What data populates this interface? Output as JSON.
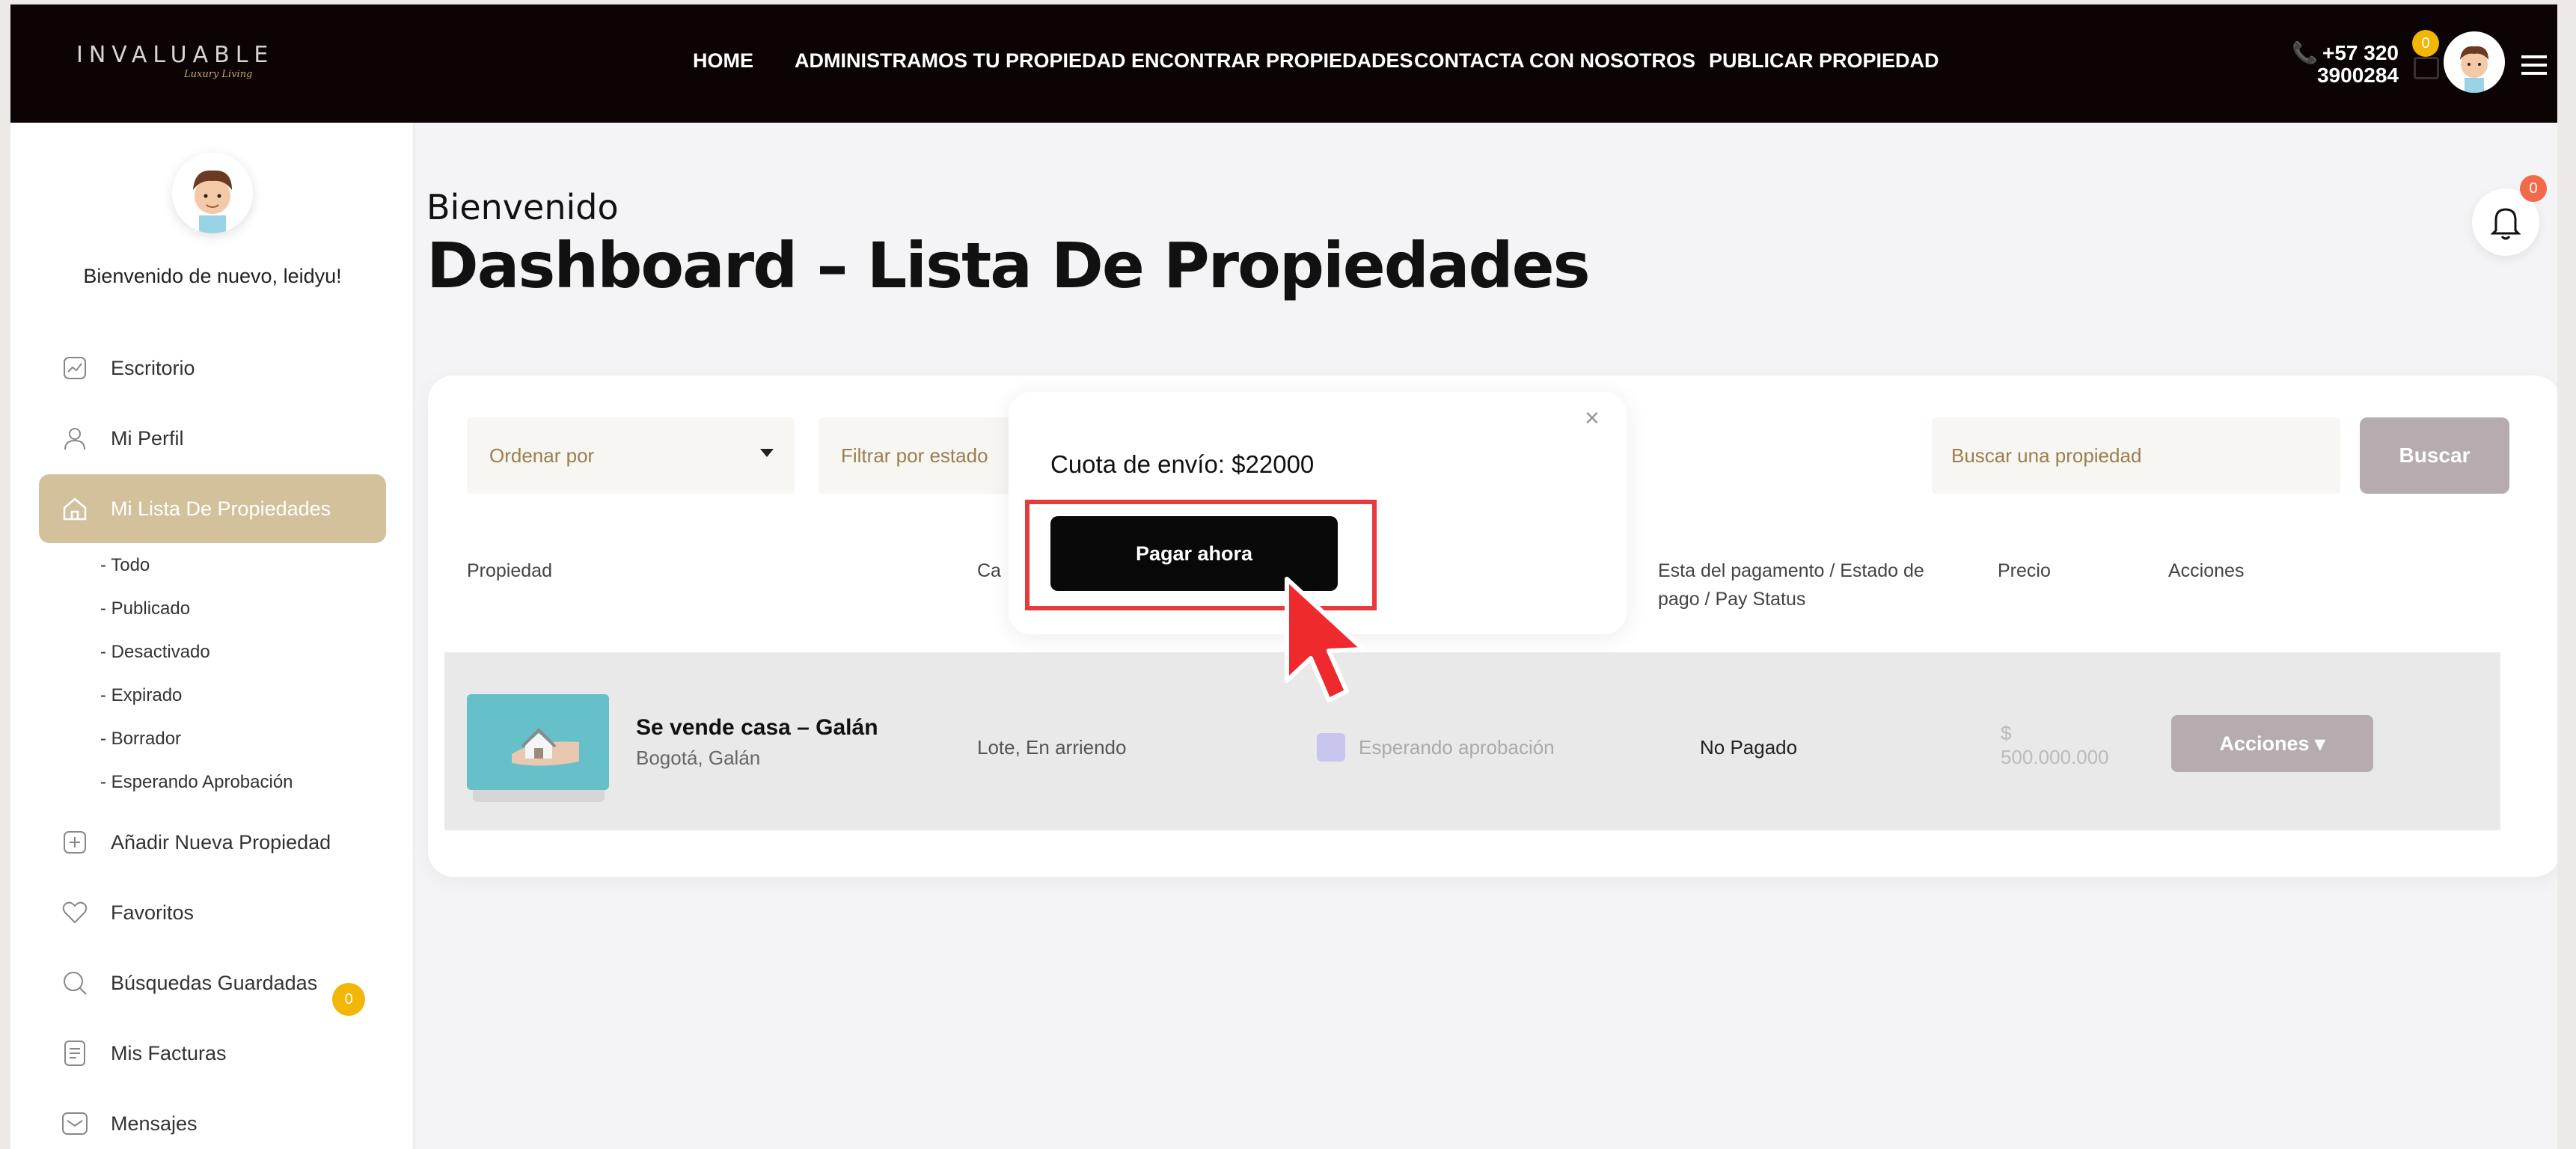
{
  "header": {
    "logo_text": "INVALUABLE",
    "logo_subtitle": "Luxury Living",
    "nav": [
      "HOME",
      "ADMINISTRAMOS TU PROPIEDAD",
      "ENCONTRAR PROPIEDADES",
      "CONTACTA CON NOSOTROS",
      "PUBLICAR PROPIEDAD"
    ],
    "phone_line1": "+57 320",
    "phone_line2": "3900284",
    "cart_count": "0"
  },
  "sidebar": {
    "welcome": "Bienvenido de nuevo, leidyu!",
    "items": [
      {
        "label": "Escritorio",
        "icon": "chart-icon"
      },
      {
        "label": "Mi Perfil",
        "icon": "user-icon"
      },
      {
        "label": "Mi Lista De Propiedades",
        "icon": "home-icon"
      },
      {
        "label": "Añadir Nueva Propiedad",
        "icon": "plus-icon"
      },
      {
        "label": "Favoritos",
        "icon": "heart-icon"
      },
      {
        "label": "Búsquedas Guardadas",
        "icon": "search-icon"
      },
      {
        "label": "Mis Facturas",
        "icon": "invoice-icon"
      },
      {
        "label": "Mensajes",
        "icon": "message-icon"
      }
    ],
    "sub_items": [
      "- Todo",
      "- Publicado",
      "- Desactivado",
      "- Expirado",
      "- Borrador",
      "- Esperando Aprobación"
    ],
    "messages_count": "0"
  },
  "main": {
    "greeting": "Bienvenido",
    "title": "Dashboard – Lista De Propiedades",
    "notifications_count": "0",
    "filters": {
      "order_by": "Ordenar por",
      "filter_by_status": "Filtrar por estado",
      "search_placeholder": "Buscar una propiedad",
      "search_button": "Buscar"
    },
    "table": {
      "headers": {
        "property": "Propiedad",
        "category": "Ca",
        "payment_status_line1": "Esta del pagamento / Estado de",
        "payment_status_line2": "pago / Pay Status",
        "price": "Precio",
        "actions": "Acciones"
      },
      "rows": [
        {
          "title": "Se vende casa – Galán",
          "location": "Bogotá, Galán",
          "category": "Lote, En arriendo",
          "status": "Esperando aprobación",
          "payment": "No Pagado",
          "price_symbol": "$",
          "price": "500.000.000",
          "actions_button": "Acciones ▾"
        }
      ]
    }
  },
  "modal": {
    "fee_text": "Cuota de envío: $22000",
    "pay_button": "Pagar ahora",
    "close": "×"
  },
  "colors": {
    "topbar": "#0c0305",
    "accent": "#d3c19c",
    "badge": "#f2b705",
    "highlight": "#e53b3b"
  }
}
